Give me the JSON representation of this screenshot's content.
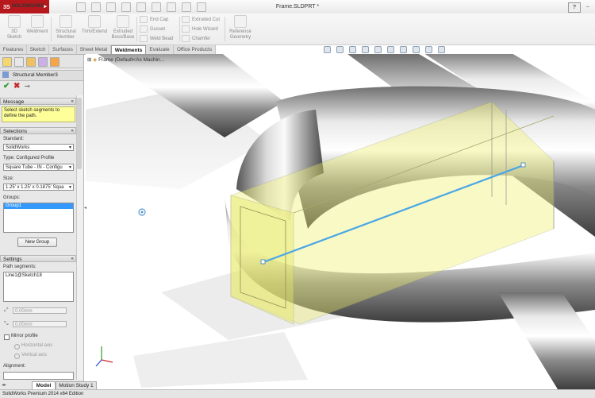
{
  "app": {
    "logo_text": "SOLIDWORKS",
    "logo_prefix": "3S",
    "doc_title": "Frame.SLDPRT *",
    "help_label": "?",
    "window_control": "–"
  },
  "ribbon": {
    "large_buttons": [
      {
        "label": "3D\nSketch"
      },
      {
        "label": "Weldment"
      },
      {
        "label": "Structural\nMember"
      },
      {
        "label": "Trim/Extend"
      },
      {
        "label": "Extruded\nBoss/Base"
      }
    ],
    "col1": [
      "End Cap",
      "Gusset",
      "Weld Bead"
    ],
    "col2": [
      "Extruded Cut",
      "Hole Wizard",
      "Chamfer"
    ],
    "ref_geometry": "Reference\nGeometry"
  },
  "tabs": [
    "Features",
    "Sketch",
    "Surfaces",
    "Sheet Metal",
    "Weldments",
    "Evaluate",
    "Office Products"
  ],
  "active_tab": "Weldments",
  "tree": {
    "root_label": "Frame  (Default<As Machin..."
  },
  "property_manager": {
    "title": "Structural Member3",
    "message_header": "Message",
    "message_text": "Select sketch segments to define the path.",
    "selections_header": "Selections",
    "standard_label": "Standard:",
    "standard_value": "SolidWorks",
    "type_label": "Type: Configured Profile",
    "type_value": "Square Tube - IN - Configu",
    "size_label": "Size:",
    "size_value": "1.25' x 1.25' x 0.1875' Squa",
    "groups_label": "Groups:",
    "group_item": "Group1",
    "new_group_button": "New Group",
    "settings_header": "Settings",
    "path_segments_label": "Path segments:",
    "path_segment_item": "Line1@Sketch18",
    "offset1": "0.00mm",
    "offset2": "0.00mm",
    "mirror_label": "Mirror profile",
    "horizontal_axis": "Horizontal axis",
    "vertical_axis": "Vertical axis",
    "alignment_label": "Alignment:"
  },
  "bottom_tabs": [
    "Model",
    "Motion Study 1"
  ],
  "status_text": "SolidWorks Premium 2014 x64 Edition",
  "colors": {
    "logo_red": "#b5191d",
    "message_yellow": "#ffff99",
    "path_line_blue": "#4aa6e6",
    "profile_yellow": "#eef06a"
  }
}
